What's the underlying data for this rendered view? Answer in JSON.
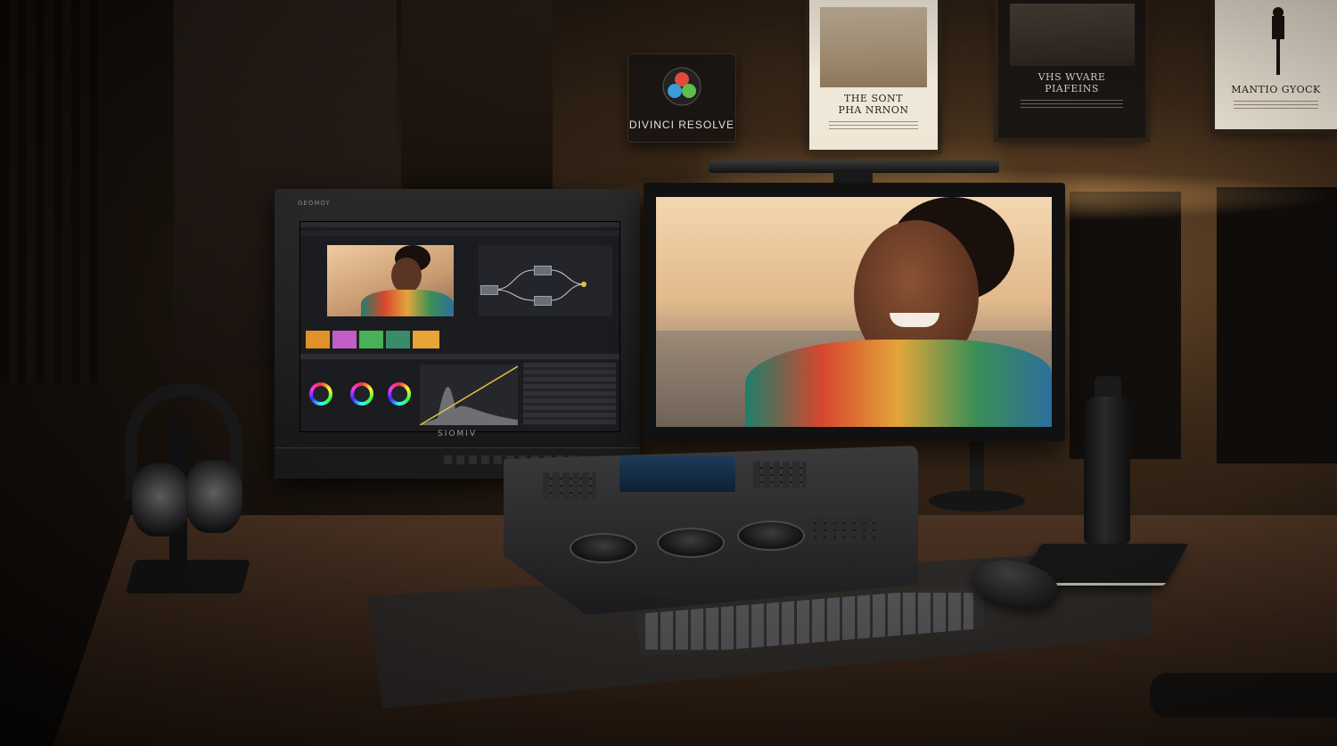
{
  "scene": {
    "sign_text": "DIVINCI RESOLVE",
    "left_monitor_top_label": "GEOMOY",
    "left_monitor_brand": "SIOMIV",
    "poster_1_title_lines": [
      "THE SONT",
      "PHA NRNON"
    ],
    "poster_2_title_lines": [
      "VHS WVARE",
      "PIAFEINS"
    ],
    "poster_3_title": "MANTIO GYOCK"
  },
  "colors": {
    "warm_light": "#ffbe6e",
    "wall_dark": "#1c140e",
    "desk_wood": "#3a271b"
  }
}
